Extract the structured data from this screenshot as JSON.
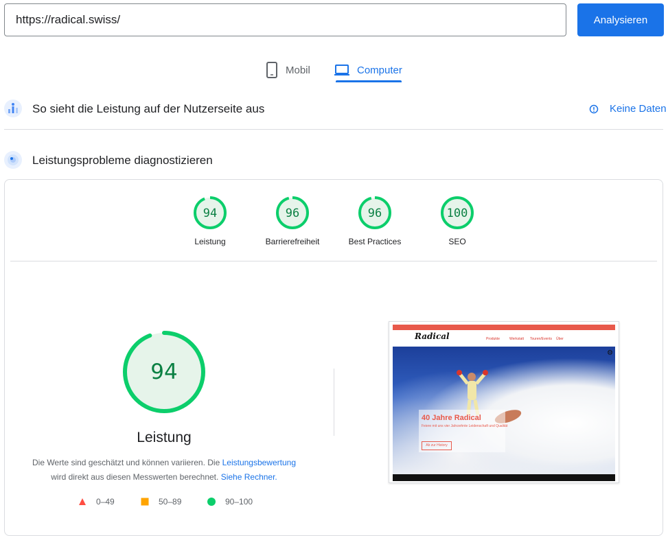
{
  "search": {
    "url_value": "https://radical.swiss/",
    "analyze_label": "Analysieren"
  },
  "tabs": [
    {
      "label": "Mobil"
    },
    {
      "label": "Computer",
      "selected": true
    }
  ],
  "field_data": {
    "title": "So sieht die Leistung auf der Nutzerseite aus",
    "no_data_label": "Keine Daten"
  },
  "diagnostics": {
    "title": "Leistungsprobleme diagnostizieren"
  },
  "categories": [
    {
      "label": "Leistung",
      "score": 94
    },
    {
      "label": "Barrierefreiheit",
      "score": 96
    },
    {
      "label": "Best Practices",
      "score": 96
    },
    {
      "label": "SEO",
      "score": 100
    }
  ],
  "main_score": {
    "score": 94,
    "title": "Leistung",
    "desc_prefix": "Die Werte sind geschätzt und können variieren. Die",
    "desc_link1": "Leistungsbewertung",
    "desc_middle": "wird direkt aus diesen Messwerten berechnet.",
    "desc_link2": "Siehe Rechner."
  },
  "legend": [
    {
      "range": "0–49",
      "shape": "triangle",
      "color": "#ff4e42"
    },
    {
      "range": "50–89",
      "shape": "square",
      "color": "#ffa400"
    },
    {
      "range": "90–100",
      "shape": "circle",
      "color": "#0cce6b"
    }
  ],
  "colors": {
    "accent": "#1a73e8",
    "pass": "#0cce6b",
    "pass_text": "#0b8043"
  },
  "thumbnail": {
    "logo": "Radical",
    "nav_items": [
      "Produkte",
      "Werkstatt",
      "Touren/Events",
      "Über"
    ],
    "hero_heading": "40 Jahre Radical",
    "hero_sub": "Feiere mit uns vier Jahrzehnte Leidenschaft und Qualität",
    "hero_button": "Ab zur History"
  }
}
